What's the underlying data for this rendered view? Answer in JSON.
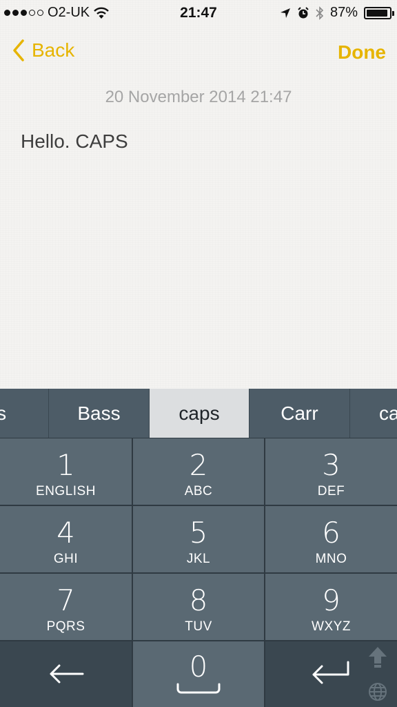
{
  "status_bar": {
    "carrier": "O2-UK",
    "time": "21:47",
    "battery_percent": "87%"
  },
  "nav": {
    "back_label": "Back",
    "done_label": "Done"
  },
  "note": {
    "timestamp": "20 November 2014 21:47",
    "text": "Hello. CAPS"
  },
  "suggestions": {
    "items": [
      "rs",
      "Bass",
      "caps",
      "Carr",
      "ca"
    ],
    "selected_index": 2
  },
  "keypad": {
    "keys": [
      {
        "num": "1",
        "letters": "ENGLISH"
      },
      {
        "num": "2",
        "letters": "ABC"
      },
      {
        "num": "3",
        "letters": "DEF"
      },
      {
        "num": "4",
        "letters": "GHI"
      },
      {
        "num": "5",
        "letters": "JKL"
      },
      {
        "num": "6",
        "letters": "MNO"
      },
      {
        "num": "7",
        "letters": "PQRS"
      },
      {
        "num": "8",
        "letters": "TUV"
      },
      {
        "num": "9",
        "letters": "WXYZ"
      }
    ],
    "zero": "0",
    "icons": {
      "backspace": "left-arrow-icon",
      "enter": "return-arrow-icon",
      "shift": "shift-up-arrow-icon",
      "globe": "globe-icon"
    }
  },
  "colors": {
    "accent": "#e6b400",
    "key_bg": "#5a6973",
    "key_dark": "#3a4750",
    "selected_suggestion": "#dcdee0"
  }
}
